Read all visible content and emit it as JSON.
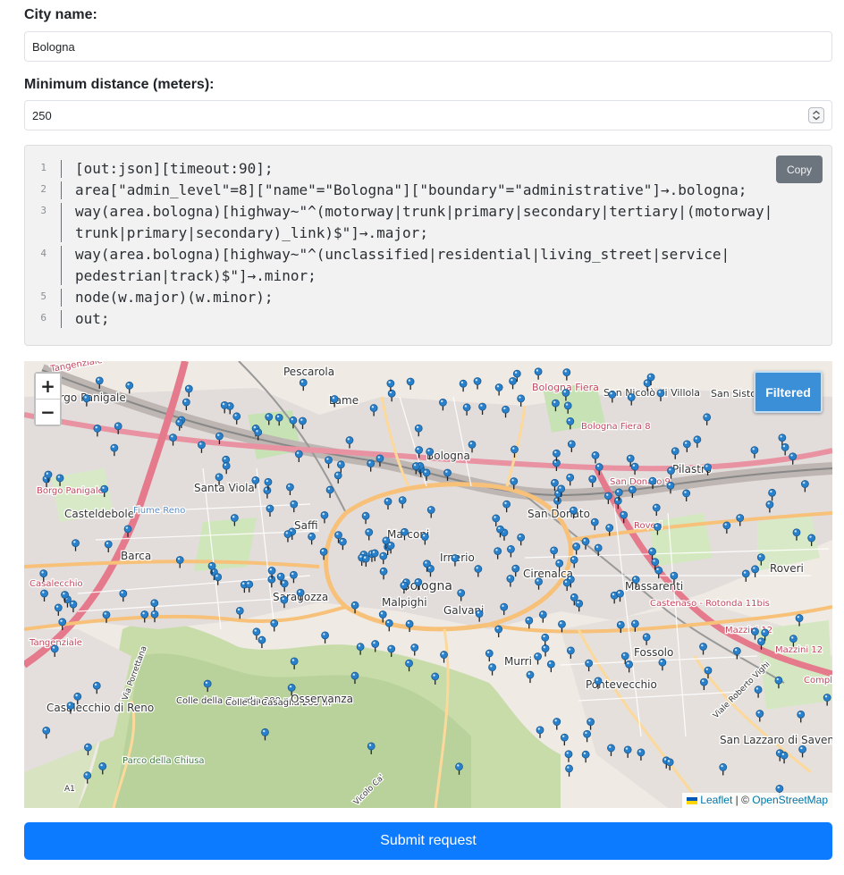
{
  "city": {
    "label": "City name:",
    "value": "Bologna"
  },
  "distance": {
    "label": "Minimum distance (meters):",
    "value": "250"
  },
  "query": {
    "copy_label": "Copy",
    "lines": [
      {
        "num": "1",
        "text": [
          "[out:json][timeout:90];"
        ]
      },
      {
        "num": "2",
        "text": [
          "area[\"admin_level\"=8][\"name\"=\"Bologna\"][\"boundary\"=\"administrative\"]→.bologna;"
        ]
      },
      {
        "num": "3",
        "text": [
          "way(area.bologna)[highway~\"^(motorway|trunk|primary|secondary|tertiary|(motorway|",
          "trunk|primary|secondary)_link)$\"]→.major;"
        ]
      },
      {
        "num": "4",
        "text": [
          "way(area.bologna)[highway~\"^(unclassified|residential|living_street|service|",
          "pedestrian|track)$\"]→.minor;"
        ]
      },
      {
        "num": "5",
        "text": [
          "node(w.major)(w.minor);"
        ]
      },
      {
        "num": "6",
        "text": [
          "out;"
        ]
      }
    ]
  },
  "map": {
    "zoom_in": "+",
    "zoom_out": "−",
    "filter_button": "Filtered",
    "attribution_leaflet": "Leaflet",
    "attribution_sep": "| ©",
    "attribution_osm": "OpenStreetMap",
    "labels": [
      "Tangenziale",
      "Pescarola",
      "Borgo Panigale",
      "Lame",
      "Bologna Fiera",
      "San Nicolò di Villola",
      "San Sisto",
      "Bologna",
      "Bologna Fiera 8",
      "Pilastro",
      "Borgo Panigale",
      "Santa Viola",
      "Casteldebole",
      "Fiume Reno",
      "San Donato 9",
      "San Donato",
      "Saffi",
      "Marconi",
      "Roveri",
      "Barca",
      "Irnerio",
      "Bologna",
      "Casalecchio",
      "Saragozza",
      "Malpighi",
      "Galvani",
      "Cirenaica",
      "Massarenti",
      "Castenaso - Rotonda 11bis",
      "Roveri",
      "Mazzini 12",
      "Mazzini 12",
      "Tangenziale",
      "Murri",
      "Fossolo",
      "Pontevecchio",
      "Casalecchio di Reno",
      "Colle della Guardia 280 m",
      "Colle di Casaglia 205 m",
      "Osservanza",
      "San Lazzaro di Savena",
      "Parco della Chiusa",
      "A1",
      "Via Porrettana",
      "Complanare",
      "Viale Roberto Vighi",
      "Vicolo Ca'"
    ],
    "pin_color": "#2a81cb",
    "pin_count": 300
  },
  "submit_label": "Submit request"
}
